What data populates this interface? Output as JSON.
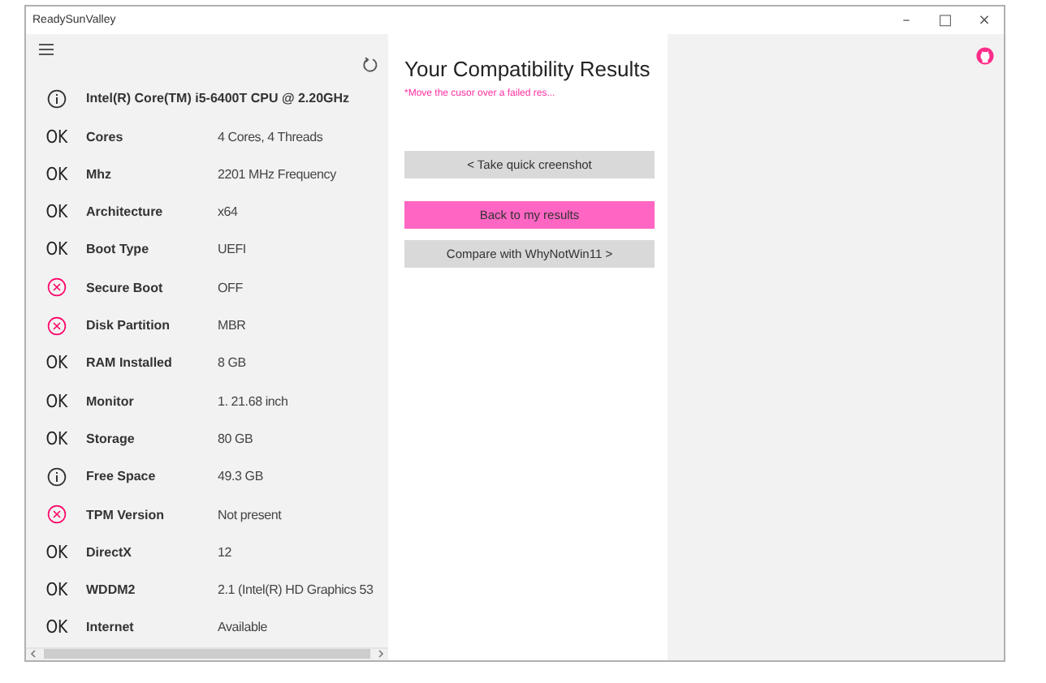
{
  "window": {
    "title": "ReadySunValley",
    "controls": [
      "–",
      "□",
      "×"
    ]
  },
  "cpu": {
    "kind": "info",
    "label": "Intel(R) Core(TM) i5-6400T CPU @ 2.20GHz"
  },
  "checks": [
    {
      "kind": "ok",
      "mark": "OK",
      "label": "Cores",
      "value": "4 Cores, 4 Threads"
    },
    {
      "kind": "ok",
      "mark": "OK",
      "label": "Mhz",
      "value": "2201 MHz Frequency"
    },
    {
      "kind": "ok",
      "mark": "OK",
      "label": "Architecture",
      "value": "x64"
    },
    {
      "kind": "ok",
      "mark": "OK",
      "label": "Boot Type",
      "value": "UEFI"
    },
    {
      "kind": "fail",
      "label": "Secure Boot",
      "value": "OFF"
    },
    {
      "kind": "fail",
      "label": "Disk Partition",
      "value": "MBR"
    },
    {
      "kind": "ok",
      "mark": "OK",
      "label": "RAM Installed",
      "value": "8 GB"
    },
    {
      "kind": "ok",
      "mark": "OK",
      "label": "Monitor",
      "value": "1. 21.68 inch"
    },
    {
      "kind": "ok",
      "mark": "OK",
      "label": "Storage",
      "value": "80 GB"
    },
    {
      "kind": "info",
      "label": "Free Space",
      "value": "49.3 GB"
    },
    {
      "kind": "fail",
      "label": "TPM Version",
      "value": "Not present"
    },
    {
      "kind": "ok",
      "mark": "OK",
      "label": "DirectX",
      "value": "12"
    },
    {
      "kind": "ok",
      "mark": "OK",
      "label": "WDDM2",
      "value": "2.1 (Intel(R) HD Graphics 53"
    },
    {
      "kind": "ok",
      "mark": "OK",
      "label": "Internet",
      "value": "Available"
    }
  ],
  "results": {
    "title": "Your Compatibility Results",
    "hint": "*Move the cusor over a failed res..."
  },
  "buttons": [
    {
      "label": "< Take quick creenshot",
      "selected": false
    },
    {
      "label": "Back to my results",
      "selected": true
    },
    {
      "label": "Compare with WhyNotWin11 >",
      "selected": false
    }
  ]
}
